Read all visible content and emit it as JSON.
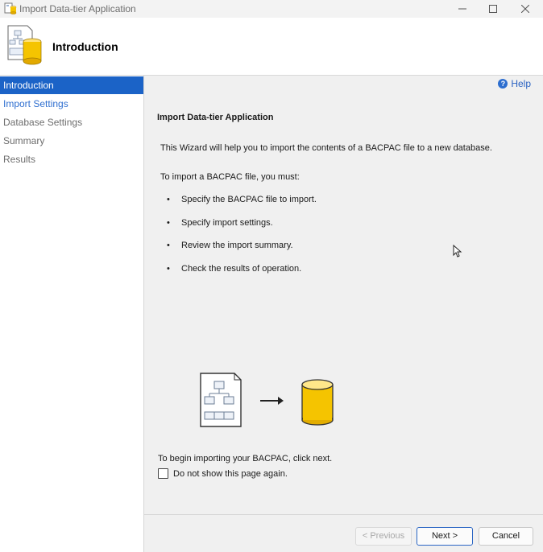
{
  "window": {
    "title": "Import Data-tier Application",
    "controls": [
      "minimize-icon",
      "maximize-icon",
      "close-icon"
    ]
  },
  "header": {
    "heading": "Introduction",
    "icon": "bacpac-database-icon"
  },
  "sidebar": {
    "items": [
      {
        "label": "Introduction",
        "state": "active"
      },
      {
        "label": "Import Settings",
        "state": "link"
      },
      {
        "label": "Database Settings",
        "state": "disabled"
      },
      {
        "label": "Summary",
        "state": "disabled"
      },
      {
        "label": "Results",
        "state": "disabled"
      }
    ]
  },
  "content": {
    "help_label": "Help",
    "section_title": "Import Data-tier Application",
    "intro_text": "This Wizard will help you to import the contents of a BACPAC file to a new database.",
    "must_text": "To import a BACPAC file, you must:",
    "bullets": [
      "Specify the BACPAC file to import.",
      "Specify import settings.",
      "Review the import summary.",
      "Check the results of operation."
    ],
    "begin_text": "To begin importing your BACPAC, click next.",
    "checkbox_label": "Do not show this page again.",
    "checkbox_checked": false
  },
  "buttons": {
    "previous": "< Previous",
    "next": "Next >",
    "cancel": "Cancel"
  },
  "colors": {
    "accent": "#1b63c7",
    "link": "#2f6fd0",
    "database_yellow": "#f5c400"
  }
}
